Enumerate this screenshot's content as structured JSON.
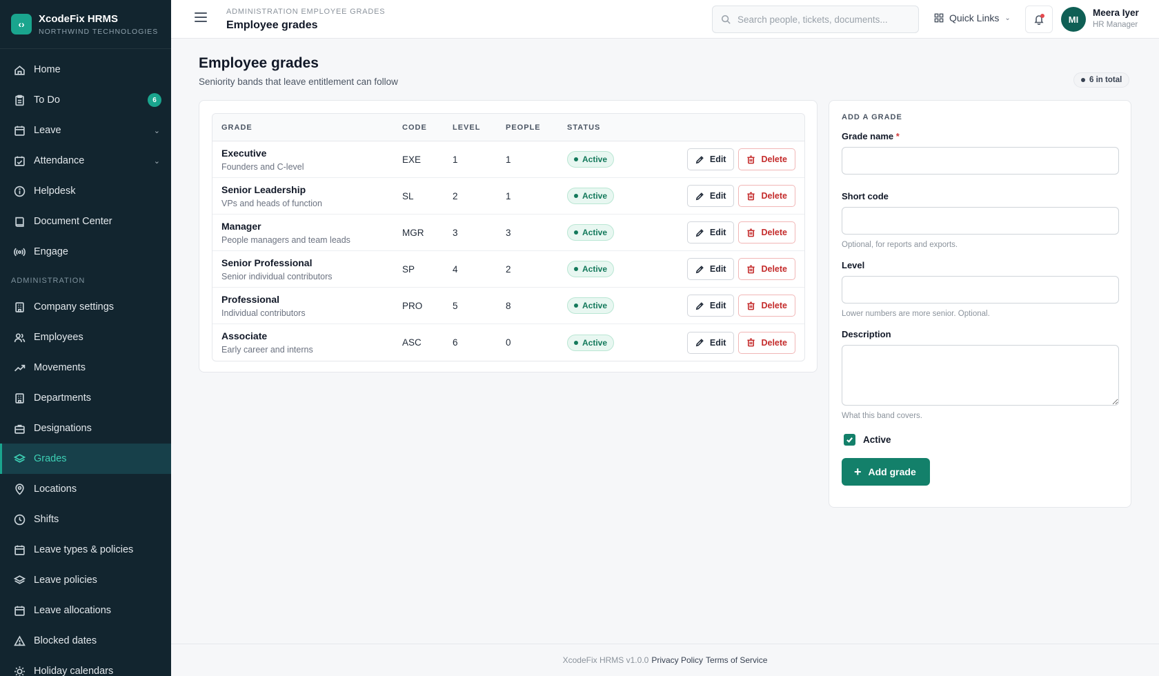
{
  "brand": {
    "name": "XcodeFix HRMS",
    "org": "NORTHWIND TECHNOLOGIES",
    "logo_glyph": "‹›"
  },
  "sidebar": {
    "items": [
      {
        "label": "Home",
        "icon": "home-icon"
      },
      {
        "label": "To Do",
        "icon": "clipboard-icon",
        "badge": "6"
      },
      {
        "label": "Leave",
        "icon": "calendar-icon",
        "expandable": true
      },
      {
        "label": "Attendance",
        "icon": "calendar-check-icon",
        "expandable": true
      },
      {
        "label": "Helpdesk",
        "icon": "info-icon"
      },
      {
        "label": "Document Center",
        "icon": "book-icon"
      },
      {
        "label": "Engage",
        "icon": "broadcast-icon"
      }
    ],
    "section_label": "ADMINISTRATION",
    "admin_items": [
      {
        "label": "Company settings",
        "icon": "building-icon"
      },
      {
        "label": "Employees",
        "icon": "users-icon"
      },
      {
        "label": "Movements",
        "icon": "trending-icon"
      },
      {
        "label": "Departments",
        "icon": "building-icon"
      },
      {
        "label": "Designations",
        "icon": "briefcase-icon"
      },
      {
        "label": "Grades",
        "icon": "layers-icon",
        "active": true
      },
      {
        "label": "Locations",
        "icon": "map-pin-icon"
      },
      {
        "label": "Shifts",
        "icon": "clock-icon"
      },
      {
        "label": "Leave types & policies",
        "icon": "calendar-icon"
      },
      {
        "label": "Leave policies",
        "icon": "layers-icon"
      },
      {
        "label": "Leave allocations",
        "icon": "calendar-icon"
      },
      {
        "label": "Blocked dates",
        "icon": "warning-icon"
      },
      {
        "label": "Holiday calendars",
        "icon": "sun-icon"
      }
    ]
  },
  "topbar": {
    "breadcrumb": "ADMINISTRATION EMPLOYEE GRADES",
    "title": "Employee grades",
    "search_placeholder": "Search people, tickets, documents...",
    "quick_links": "Quick Links",
    "user": {
      "initials": "MI",
      "name": "Meera Iyer",
      "role": "HR Manager"
    }
  },
  "page": {
    "title": "Employee grades",
    "subtitle": "Seniority bands that leave entitlement can follow",
    "total_badge": "6 in total"
  },
  "table": {
    "headers": [
      "GRADE",
      "CODE",
      "LEVEL",
      "PEOPLE",
      "STATUS"
    ],
    "edit_label": "Edit",
    "delete_label": "Delete",
    "rows": [
      {
        "name": "Executive",
        "desc": "Founders and C-level",
        "code": "EXE",
        "level": "1",
        "people": "1",
        "status": "Active"
      },
      {
        "name": "Senior Leadership",
        "desc": "VPs and heads of function",
        "code": "SL",
        "level": "2",
        "people": "1",
        "status": "Active"
      },
      {
        "name": "Manager",
        "desc": "People managers and team leads",
        "code": "MGR",
        "level": "3",
        "people": "3",
        "status": "Active"
      },
      {
        "name": "Senior Professional",
        "desc": "Senior individual contributors",
        "code": "SP",
        "level": "4",
        "people": "2",
        "status": "Active"
      },
      {
        "name": "Professional",
        "desc": "Individual contributors",
        "code": "PRO",
        "level": "5",
        "people": "8",
        "status": "Active"
      },
      {
        "name": "Associate",
        "desc": "Early career and interns",
        "code": "ASC",
        "level": "6",
        "people": "0",
        "status": "Active"
      }
    ]
  },
  "form": {
    "title": "ADD A GRADE",
    "grade_name_label": "Grade name",
    "required_mark": "*",
    "grade_name_value": "",
    "short_code_label": "Short code",
    "short_code_value": "",
    "short_code_help": "Optional, for reports and exports.",
    "level_label": "Level",
    "level_value": "",
    "level_help": "Lower numbers are more senior. Optional.",
    "description_label": "Description",
    "description_value": "",
    "description_help": "What this band covers.",
    "active_label": "Active",
    "active_checked": true,
    "submit_label": "Add grade"
  },
  "footer": {
    "version": "XcodeFix HRMS v1.0.0",
    "privacy": "Privacy Policy",
    "terms": "Terms of Service"
  },
  "colors": {
    "accent": "#13806a",
    "sidebar_bg": "#12252f",
    "active_text": "#3dd0b5",
    "danger": "#c42b2b"
  }
}
